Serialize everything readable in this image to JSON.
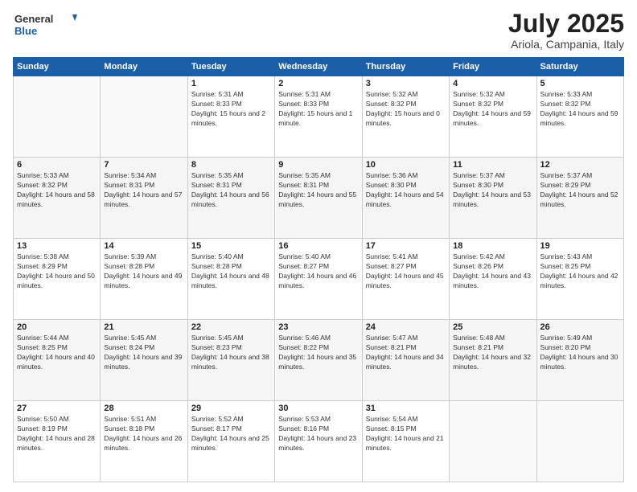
{
  "header": {
    "logo_general": "General",
    "logo_blue": "Blue",
    "month": "July 2025",
    "location": "Ariola, Campania, Italy"
  },
  "days_of_week": [
    "Sunday",
    "Monday",
    "Tuesday",
    "Wednesday",
    "Thursday",
    "Friday",
    "Saturday"
  ],
  "weeks": [
    [
      {
        "day": "",
        "info": ""
      },
      {
        "day": "",
        "info": ""
      },
      {
        "day": "1",
        "sunrise": "5:31 AM",
        "sunset": "8:33 PM",
        "daylight": "15 hours and 2 minutes."
      },
      {
        "day": "2",
        "sunrise": "5:31 AM",
        "sunset": "8:33 PM",
        "daylight": "15 hours and 1 minute."
      },
      {
        "day": "3",
        "sunrise": "5:32 AM",
        "sunset": "8:32 PM",
        "daylight": "15 hours and 0 minutes."
      },
      {
        "day": "4",
        "sunrise": "5:32 AM",
        "sunset": "8:32 PM",
        "daylight": "14 hours and 59 minutes."
      },
      {
        "day": "5",
        "sunrise": "5:33 AM",
        "sunset": "8:32 PM",
        "daylight": "14 hours and 59 minutes."
      }
    ],
    [
      {
        "day": "6",
        "sunrise": "5:33 AM",
        "sunset": "8:32 PM",
        "daylight": "14 hours and 58 minutes."
      },
      {
        "day": "7",
        "sunrise": "5:34 AM",
        "sunset": "8:31 PM",
        "daylight": "14 hours and 57 minutes."
      },
      {
        "day": "8",
        "sunrise": "5:35 AM",
        "sunset": "8:31 PM",
        "daylight": "14 hours and 56 minutes."
      },
      {
        "day": "9",
        "sunrise": "5:35 AM",
        "sunset": "8:31 PM",
        "daylight": "14 hours and 55 minutes."
      },
      {
        "day": "10",
        "sunrise": "5:36 AM",
        "sunset": "8:30 PM",
        "daylight": "14 hours and 54 minutes."
      },
      {
        "day": "11",
        "sunrise": "5:37 AM",
        "sunset": "8:30 PM",
        "daylight": "14 hours and 53 minutes."
      },
      {
        "day": "12",
        "sunrise": "5:37 AM",
        "sunset": "8:29 PM",
        "daylight": "14 hours and 52 minutes."
      }
    ],
    [
      {
        "day": "13",
        "sunrise": "5:38 AM",
        "sunset": "8:29 PM",
        "daylight": "14 hours and 50 minutes."
      },
      {
        "day": "14",
        "sunrise": "5:39 AM",
        "sunset": "8:28 PM",
        "daylight": "14 hours and 49 minutes."
      },
      {
        "day": "15",
        "sunrise": "5:40 AM",
        "sunset": "8:28 PM",
        "daylight": "14 hours and 48 minutes."
      },
      {
        "day": "16",
        "sunrise": "5:40 AM",
        "sunset": "8:27 PM",
        "daylight": "14 hours and 46 minutes."
      },
      {
        "day": "17",
        "sunrise": "5:41 AM",
        "sunset": "8:27 PM",
        "daylight": "14 hours and 45 minutes."
      },
      {
        "day": "18",
        "sunrise": "5:42 AM",
        "sunset": "8:26 PM",
        "daylight": "14 hours and 43 minutes."
      },
      {
        "day": "19",
        "sunrise": "5:43 AM",
        "sunset": "8:25 PM",
        "daylight": "14 hours and 42 minutes."
      }
    ],
    [
      {
        "day": "20",
        "sunrise": "5:44 AM",
        "sunset": "8:25 PM",
        "daylight": "14 hours and 40 minutes."
      },
      {
        "day": "21",
        "sunrise": "5:45 AM",
        "sunset": "8:24 PM",
        "daylight": "14 hours and 39 minutes."
      },
      {
        "day": "22",
        "sunrise": "5:45 AM",
        "sunset": "8:23 PM",
        "daylight": "14 hours and 38 minutes."
      },
      {
        "day": "23",
        "sunrise": "5:46 AM",
        "sunset": "8:22 PM",
        "daylight": "14 hours and 35 minutes."
      },
      {
        "day": "24",
        "sunrise": "5:47 AM",
        "sunset": "8:21 PM",
        "daylight": "14 hours and 34 minutes."
      },
      {
        "day": "25",
        "sunrise": "5:48 AM",
        "sunset": "8:21 PM",
        "daylight": "14 hours and 32 minutes."
      },
      {
        "day": "26",
        "sunrise": "5:49 AM",
        "sunset": "8:20 PM",
        "daylight": "14 hours and 30 minutes."
      }
    ],
    [
      {
        "day": "27",
        "sunrise": "5:50 AM",
        "sunset": "8:19 PM",
        "daylight": "14 hours and 28 minutes."
      },
      {
        "day": "28",
        "sunrise": "5:51 AM",
        "sunset": "8:18 PM",
        "daylight": "14 hours and 26 minutes."
      },
      {
        "day": "29",
        "sunrise": "5:52 AM",
        "sunset": "8:17 PM",
        "daylight": "14 hours and 25 minutes."
      },
      {
        "day": "30",
        "sunrise": "5:53 AM",
        "sunset": "8:16 PM",
        "daylight": "14 hours and 23 minutes."
      },
      {
        "day": "31",
        "sunrise": "5:54 AM",
        "sunset": "8:15 PM",
        "daylight": "14 hours and 21 minutes."
      },
      {
        "day": "",
        "info": ""
      },
      {
        "day": "",
        "info": ""
      }
    ]
  ]
}
